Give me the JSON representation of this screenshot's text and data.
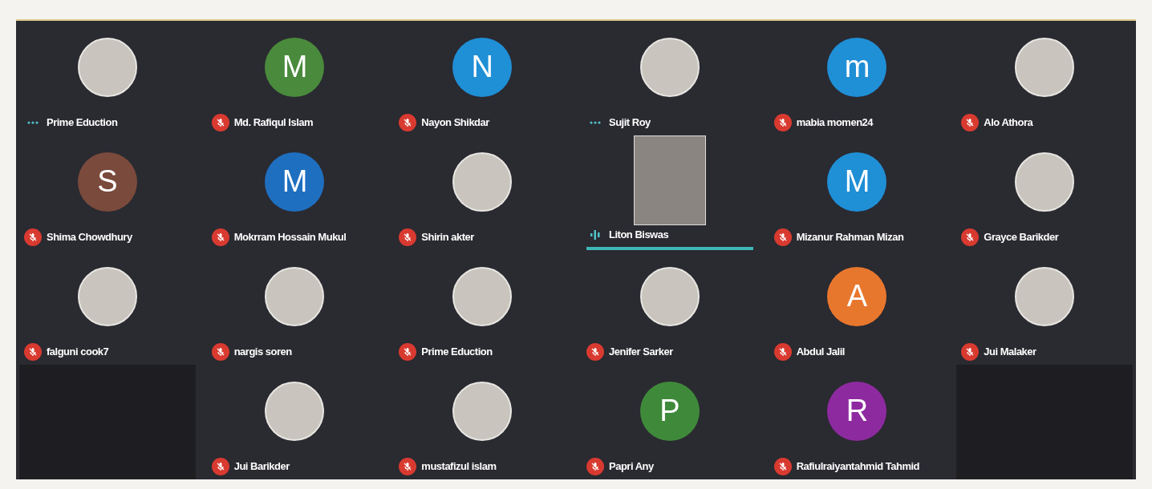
{
  "tiles": [
    {
      "kind": "photo",
      "name": "Prime Eduction",
      "muted": false,
      "speaking": false
    },
    {
      "kind": "letter",
      "letter": "M",
      "color": "#4a8a3c",
      "name": "Md. Rafiqul Islam",
      "muted": true,
      "speaking": false
    },
    {
      "kind": "letter",
      "letter": "N",
      "color": "#1f8fd6",
      "name": "Nayon Shikdar",
      "muted": true,
      "speaking": false
    },
    {
      "kind": "photo",
      "name": "Sujit Roy",
      "muted": false,
      "speaking": false
    },
    {
      "kind": "letter",
      "letter": "m",
      "color": "#1f8fd6",
      "name": "mabia momen24",
      "muted": true,
      "speaking": false
    },
    {
      "kind": "photo",
      "name": "Alo Athora",
      "muted": true,
      "speaking": false
    },
    {
      "kind": "letter",
      "letter": "S",
      "color": "#7a4a3c",
      "name": "Shima Chowdhury",
      "muted": true,
      "speaking": false
    },
    {
      "kind": "letter",
      "letter": "M",
      "color": "#1f6fc0",
      "name": "Mokrram Hossain Mukul",
      "muted": true,
      "speaking": false
    },
    {
      "kind": "photo",
      "name": "Shirin akter",
      "muted": true,
      "speaking": false
    },
    {
      "kind": "video",
      "name": "Liton Biswas",
      "muted": false,
      "speaking": true
    },
    {
      "kind": "letter",
      "letter": "M",
      "color": "#1f8fd6",
      "name": "Mizanur Rahman Mizan",
      "muted": true,
      "speaking": false
    },
    {
      "kind": "photo",
      "name": "Grayce Barikder",
      "muted": true,
      "speaking": false
    },
    {
      "kind": "photo",
      "name": "falguni cook7",
      "muted": true,
      "speaking": false
    },
    {
      "kind": "photo",
      "name": "nargis soren",
      "muted": true,
      "speaking": false
    },
    {
      "kind": "photo",
      "name": "Prime Eduction",
      "muted": true,
      "speaking": false
    },
    {
      "kind": "photo",
      "name": "Jenifer Sarker",
      "muted": true,
      "speaking": false
    },
    {
      "kind": "letter",
      "letter": "A",
      "color": "#e8772e",
      "name": "Abdul Jalil",
      "muted": true,
      "speaking": false
    },
    {
      "kind": "photo",
      "name": "Jui Malaker",
      "muted": true,
      "speaking": false
    },
    {
      "kind": "empty"
    },
    {
      "kind": "photo",
      "name": "Jui Barikder",
      "muted": true,
      "speaking": false
    },
    {
      "kind": "photo",
      "name": "mustafizul islam",
      "muted": true,
      "speaking": false
    },
    {
      "kind": "letter",
      "letter": "P",
      "color": "#3f8a3a",
      "name": "Papri Any",
      "muted": true,
      "speaking": false
    },
    {
      "kind": "letter",
      "letter": "R",
      "color": "#8e2aa0",
      "name": "Rafiulraiyantahmid Tahmid",
      "muted": true,
      "speaking": false
    },
    {
      "kind": "empty"
    }
  ]
}
